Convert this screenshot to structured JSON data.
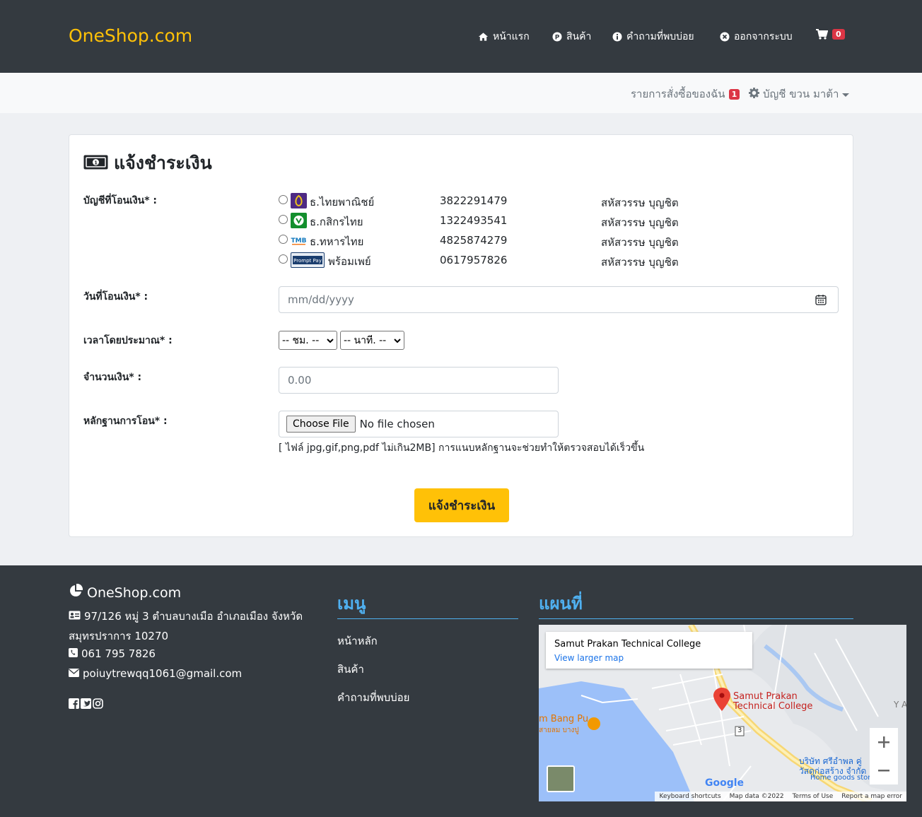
{
  "header": {
    "brand": "OneShop.com",
    "nav": [
      {
        "label": "หน้าแรก",
        "icon": "home-icon"
      },
      {
        "label": "สินค้า",
        "icon": "product-icon"
      },
      {
        "label": "คำถามที่พบบ่อย",
        "icon": "info-icon"
      },
      {
        "label": "ออกจากระบบ",
        "icon": "close-circle-icon"
      }
    ],
    "cart_count": "0"
  },
  "subnav": {
    "orders_label": "รายการสั่งซื้อของฉัน",
    "orders_count": "1",
    "account_label": "บัญชี ขวน มาต้า"
  },
  "form": {
    "title": "แจ้งชำระเงิน",
    "account_label": "บัญชีที่โอนเงิน* :",
    "banks": [
      {
        "name": "ธ.ไทยพาณิชย์",
        "account": "3822291479",
        "owner": "สหัสวรรษ บุญชิต",
        "color": "#4e2a84"
      },
      {
        "name": "ธ.กสิกรไทย",
        "account": "1322493541",
        "owner": "สหัสวรรษ บุญชิต",
        "color": "#138f2d"
      },
      {
        "name": "ธ.ทหารไทย",
        "account": "4825874279",
        "owner": "สหัสวรรษ บุญชิต",
        "color": "#1279be"
      },
      {
        "name": "พร้อมเพย์",
        "account": "0617957826",
        "owner": "สหัสวรรษ บุญชิต",
        "color": "#1a3d6e"
      }
    ],
    "date_label": "วันที่โอนเงิน* :",
    "date_placeholder": "mm/dd/yyyy",
    "time_label": "เวลาโดยประมาณ* :",
    "hour_select": "-- ชม. --",
    "minute_select": "-- นาที. --",
    "amount_label": "จำนวนเงิน* :",
    "amount_placeholder": "0.00",
    "proof_label": "หลักฐานการโอน* :",
    "file_button": "Choose File",
    "file_status": "No file chosen",
    "file_hint": "[ ไฟล์ jpg,gif,png,pdf ไม่เกิน2MB] การแนบหลักฐานจะช่วยทำให้ตรวจสอบได้เร็วขึ้น",
    "submit_label": "แจ้งชำระเงิน"
  },
  "footer": {
    "brand": "OneShop.com",
    "address_line1": "97/126 หมู่ 3 ตำบลบางเมือ อำเภอเมือง จังหวัด",
    "address_line2": "สมุทรปราการ 10270",
    "phone": "061 795 7826",
    "email": "poiuytrewqq1061@gmail.com",
    "menu_title": "เมนู",
    "menu_items": [
      "หน้าหลัก",
      "สินค้า",
      "คำถามที่พบบ่อย"
    ],
    "map_title": "แผนที่",
    "map": {
      "place_name": "Samut Prakan Technical College",
      "view_larger": "View larger map",
      "pin_label_1": "Samut Prakan",
      "pin_label_2": "Technical College",
      "poi_label": "m Bang Pu",
      "poi_label_th": "สายลม บางปู",
      "company_th_1": "บริษัท ศรีอำพล คู่",
      "company_th_2": "วัสดุก่อสร้าง จำกัด",
      "company_en": "Home goods store",
      "road_sign": "3",
      "edge_label": "Y A",
      "google": "Google",
      "shortcuts": "Keyboard shortcuts",
      "map_data": "Map data ©2022",
      "terms": "Terms of Use",
      "report": "Report a map error"
    }
  }
}
